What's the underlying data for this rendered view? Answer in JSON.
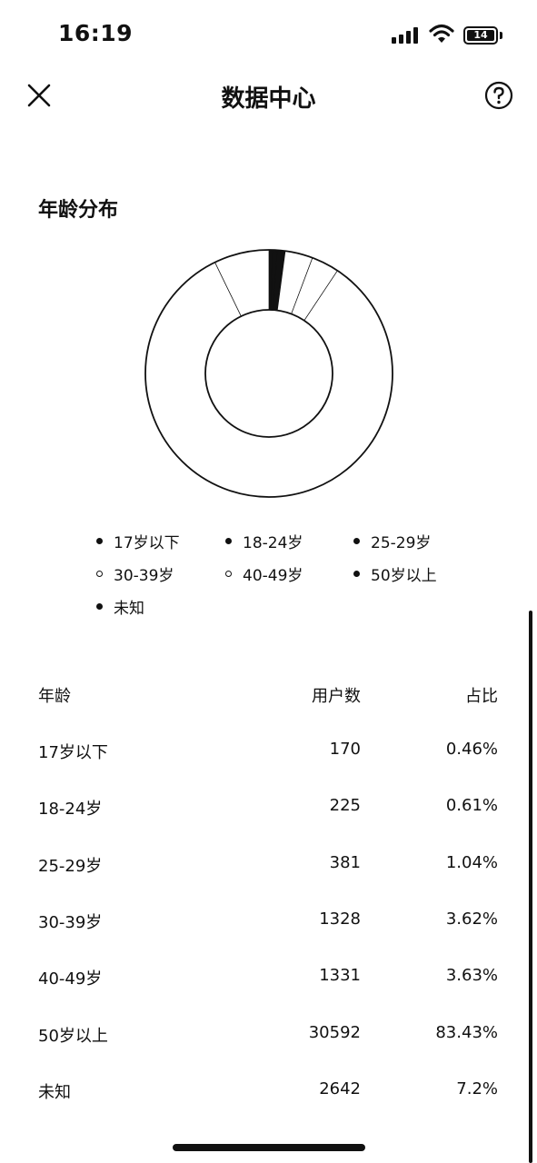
{
  "status_bar": {
    "time": "16:19",
    "battery": "14"
  },
  "nav": {
    "title": "数据中心"
  },
  "section": {
    "title": "年龄分布"
  },
  "chart_data": {
    "type": "pie",
    "style": "donut",
    "categories": [
      "17岁以下",
      "18-24岁",
      "25-29岁",
      "30-39岁",
      "40-49岁",
      "50岁以上",
      "未知"
    ],
    "values": [
      0.46,
      0.61,
      1.04,
      3.62,
      3.63,
      83.43,
      7.2
    ],
    "legend_position": "bottom"
  },
  "legend": {
    "items": [
      {
        "label": "17岁以下",
        "filled": true
      },
      {
        "label": "18-24岁",
        "filled": true
      },
      {
        "label": "25-29岁",
        "filled": true
      },
      {
        "label": "30-39岁",
        "filled": false
      },
      {
        "label": "40-49岁",
        "filled": false
      },
      {
        "label": "50岁以上",
        "filled": true
      },
      {
        "label": "未知",
        "filled": true
      }
    ]
  },
  "table": {
    "headers": {
      "age": "年龄",
      "users": "用户数",
      "percent": "占比"
    },
    "rows": [
      {
        "age": "17岁以下",
        "users": "170",
        "percent": "0.46%"
      },
      {
        "age": "18-24岁",
        "users": "225",
        "percent": "0.61%"
      },
      {
        "age": "25-29岁",
        "users": "381",
        "percent": "1.04%"
      },
      {
        "age": "30-39岁",
        "users": "1328",
        "percent": "3.62%"
      },
      {
        "age": "40-49岁",
        "users": "1331",
        "percent": "3.63%"
      },
      {
        "age": "50岁以上",
        "users": "30592",
        "percent": "83.43%"
      },
      {
        "age": "未知",
        "users": "2642",
        "percent": "7.2%"
      }
    ]
  }
}
